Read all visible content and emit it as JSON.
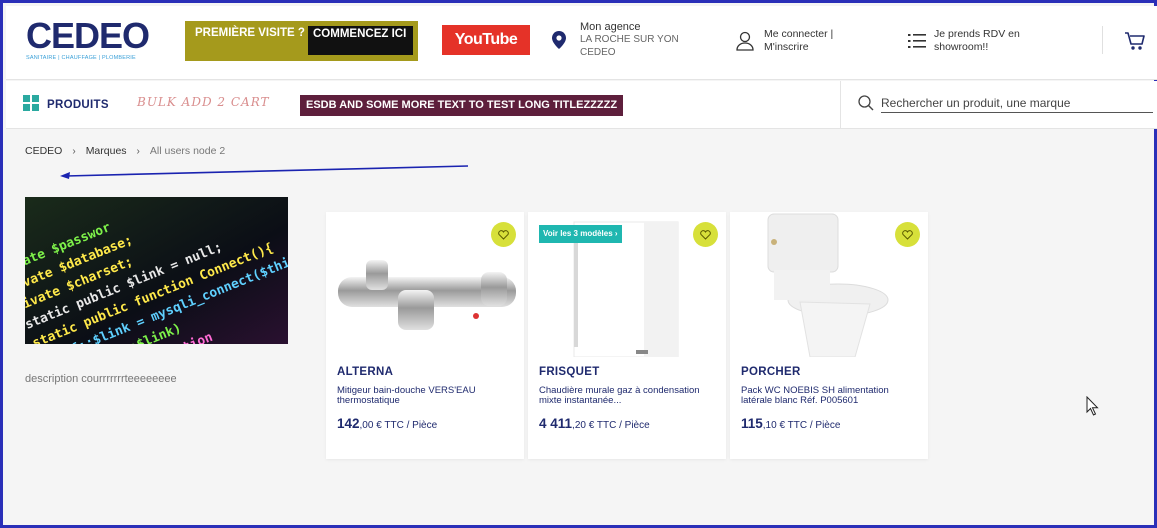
{
  "header": {
    "logo": {
      "text": "CEDEO",
      "subtitle": "SANITAIRE | CHAUFFAGE | PLOMBERIE"
    },
    "first_visit": {
      "label": "PREMIÈRE VISITE ?",
      "cta": "COMMENCEZ ICI"
    },
    "youtube_label": "YouTube",
    "agency": {
      "title": "Mon agence",
      "line1": "LA ROCHE SUR YON",
      "line2": "CEDEO"
    },
    "login": {
      "text": "Me connecter | M'inscrire"
    },
    "showroom": {
      "text": "Je prends RDV en showroom!!"
    }
  },
  "nav": {
    "products_label": "PRODUITS",
    "bulk_add": "BULK ADD 2 CART",
    "long_title": "ESDB AND SOME MORE TEXT TO TEST LONG TITLEZZZZZ",
    "search_placeholder": "Rechercher un produit, une marque"
  },
  "breadcrumb": [
    "CEDEO",
    "Marques",
    "All users node 2"
  ],
  "brand": {
    "description": "description courrrrrrrteeeeeeee",
    "image_icon": "code-screen-image",
    "code_lines": [
      "private $passwor",
      "private $database;",
      "private $charset;",
      "static public $link = null;",
      "static public function Connect(){",
      "self::$link = mysqli_connect($this->",
      "if (!self::$link)",
      "throw new Exception"
    ]
  },
  "products": [
    {
      "brand": "ALTERNA",
      "description": "Mitigeur bain-douche VERS'EAU thermostatique",
      "price_int": "142",
      "price_dec": ",00 € TTC / Pièce",
      "image_icon": "bath-mixer-tap-image",
      "models_badge": ""
    },
    {
      "brand": "FRISQUET",
      "description": "Chaudière murale gaz à condensation mixte instantanée...",
      "price_int": "4 411",
      "price_dec": ",20 € TTC / Pièce",
      "image_icon": "wall-boiler-image",
      "models_badge": "Voir les 3 modèles ›"
    },
    {
      "brand": "PORCHER",
      "description": "Pack WC NOEBIS SH alimentation latérale blanc Réf. P005601",
      "price_int": "115",
      "price_dec": ",10 € TTC / Pièce",
      "image_icon": "toilet-pack-image",
      "models_badge": ""
    }
  ],
  "colors": {
    "brand_navy": "#1f2a6e",
    "first_visit_bg": "#a59a1c",
    "youtube_red": "#e53228",
    "long_title_bg": "#5e1f3c",
    "favorite_yellow": "#d7e03a",
    "models_teal": "#1fb7b0",
    "annotation_blue": "#1a23b0"
  }
}
